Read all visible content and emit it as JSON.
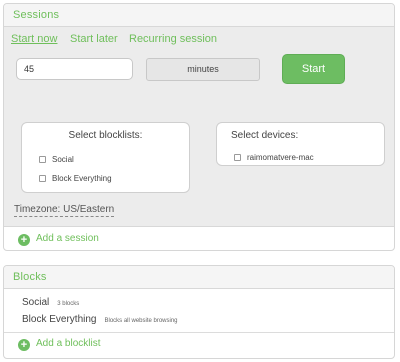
{
  "sessions": {
    "header": "Sessions",
    "tabs": [
      "Start now",
      "Start later",
      "Recurring session"
    ],
    "duration_value": "45",
    "duration_unit": "minutes",
    "start_label": "Start",
    "blocklists": {
      "title": "Select blocklists:",
      "options": [
        "Social",
        "Block Everything"
      ]
    },
    "devices": {
      "title": "Select devices:",
      "options": [
        "raimomatvere-mac"
      ]
    },
    "timezone": "Timezone: US/Eastern",
    "add_label": "Add a session"
  },
  "blocks": {
    "header": "Blocks",
    "items": [
      {
        "name": "Social",
        "meta": "3 blocks"
      },
      {
        "name": "Block Everything",
        "meta": "Blocks all website browsing"
      }
    ],
    "add_label": "Add a blocklist"
  },
  "colors": {
    "accent": "#6dbd62",
    "panel_gray": "#ececec"
  },
  "icons": {
    "add": "plus-circle-icon",
    "checkbox": "checkbox-icon"
  }
}
